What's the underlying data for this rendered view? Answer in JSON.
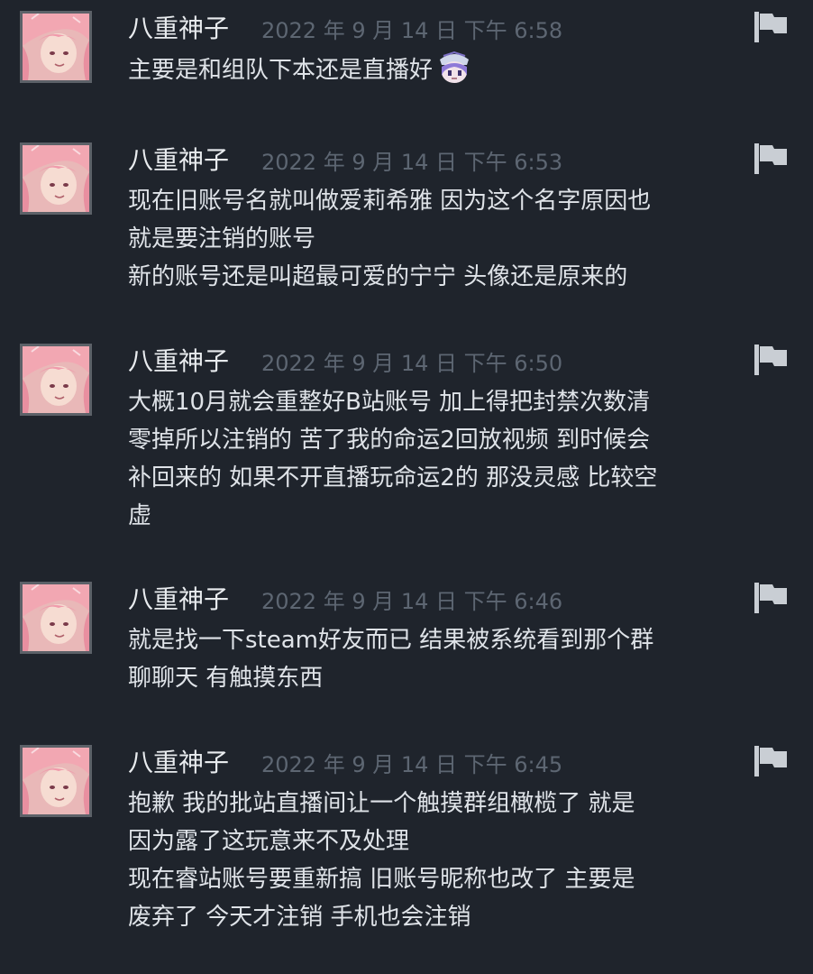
{
  "comments": [
    {
      "author": "八重神子",
      "timestamp": "2022 年 9 月 14 日 下午 6:58",
      "lines": [
        "主要是和组队下本还是直播好"
      ],
      "has_emoji": true
    },
    {
      "author": "八重神子",
      "timestamp": "2022 年 9 月 14 日 下午 6:53",
      "lines": [
        "现在旧账号名就叫做爱莉希雅 因为这个名字原因也",
        "就是要注销的账号",
        "新的账号还是叫超最可爱的宁宁 头像还是原来的"
      ]
    },
    {
      "author": "八重神子",
      "timestamp": "2022 年 9 月 14 日 下午 6:50",
      "lines": [
        "大概10月就会重整好B站账号 加上得把封禁次数清",
        "零掉所以注销的 苦了我的命运2回放视频 到时候会",
        "补回来的 如果不开直播玩命运2的 那没灵感 比较空",
        "虚"
      ]
    },
    {
      "author": "八重神子",
      "timestamp": "2022 年 9 月 14 日 下午 6:46",
      "lines": [
        "就是找一下steam好友而已 结果被系统看到那个群",
        "聊聊天 有触摸东西"
      ]
    },
    {
      "author": "八重神子",
      "timestamp": "2022 年 9 月 14 日 下午 6:45",
      "lines": [
        "抱歉 我的批站直播间让一个触摸群组橄榄了 就是",
        "因为露了这玩意来不及处理",
        "现在睿站账号要重新搞 旧账号昵称也改了 主要是",
        "废弃了 今天才注销 手机也会注销"
      ]
    }
  ],
  "icons": {
    "avatar": "anime-avatar-icon",
    "report": "flag-icon",
    "emoji": "emoticon-icon"
  },
  "colors": {
    "background": "#1f242c",
    "author": "#e8ebee",
    "timestamp": "#5d6672",
    "body": "#dfe3e8",
    "flag": "#c9ced4"
  }
}
